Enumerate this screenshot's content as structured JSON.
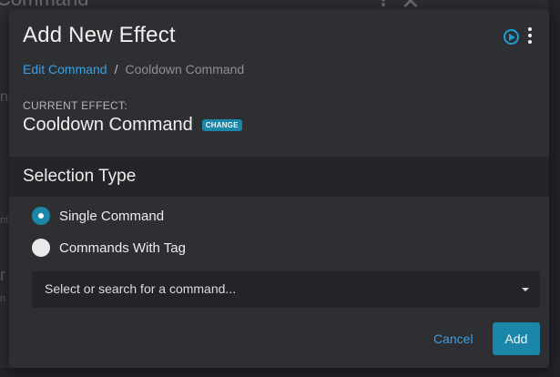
{
  "background": {
    "title": "Command",
    "fragments": [
      "ns",
      "nt",
      "r",
      "n"
    ]
  },
  "modal": {
    "title": "Add New Effect",
    "icons": {
      "play": "play-circle-icon",
      "menu": "kebab-menu-icon"
    },
    "breadcrumb": {
      "link": "Edit Command",
      "separator": "/",
      "current": "Cooldown Command"
    },
    "current_effect": {
      "label": "CURRENT EFFECT:",
      "name": "Cooldown Command",
      "change_label": "CHANGE"
    },
    "selection_type": {
      "title": "Selection Type",
      "options": [
        {
          "label": "Single Command",
          "checked": true
        },
        {
          "label": "Commands With Tag",
          "checked": false
        }
      ]
    },
    "command_select": {
      "placeholder": "Select or search for a command..."
    },
    "footer": {
      "cancel_label": "Cancel",
      "add_label": "Add"
    }
  },
  "colors": {
    "accent": "#1b87a8",
    "link": "#3aa0e2",
    "modal_bg": "#2e2f33",
    "header_bg": "#242528"
  }
}
